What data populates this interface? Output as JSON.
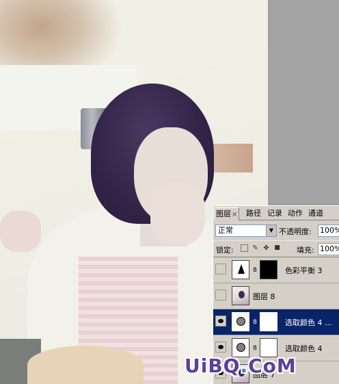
{
  "panel": {
    "tabs": [
      {
        "label": "图层",
        "close": "×"
      },
      {
        "label": "路径"
      },
      {
        "label": "记录"
      },
      {
        "label": "动作"
      },
      {
        "label": "通道"
      }
    ],
    "blend_mode": "正常",
    "opacity_label": "不透明度:",
    "opacity_value": "100%",
    "lock_label": "锁定:",
    "fill_label": "填充:",
    "fill_value": "100%",
    "layers": [
      {
        "name": "色彩平衡 3",
        "visible": false,
        "selected": false
      },
      {
        "name": "图层 8",
        "visible": false,
        "selected": false
      },
      {
        "name": "选取颜色 4 ...",
        "visible": true,
        "selected": true
      },
      {
        "name": "选取颜色 4",
        "visible": true,
        "selected": false
      },
      {
        "name": "图层 7",
        "visible": true,
        "selected": false
      }
    ]
  },
  "watermark": {
    "part1": "UiBQ",
    "part2": ".",
    "part3": "CoM"
  },
  "colors": {
    "selection": "#0a246a",
    "panel": "#d4d0c8",
    "workspace": "#a3a3a3"
  }
}
